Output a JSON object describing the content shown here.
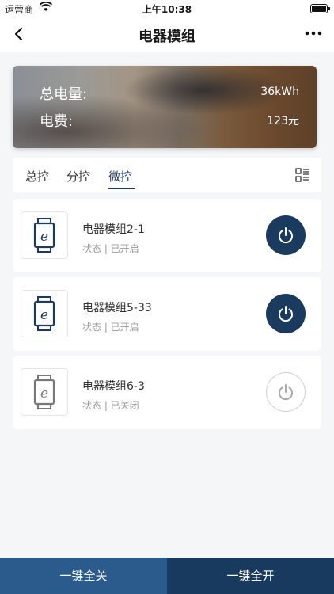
{
  "status_bar": {
    "carrier": "运营商",
    "time": "上午10:38"
  },
  "nav": {
    "title": "电器模组"
  },
  "summary": {
    "total_label": "总电量:",
    "total_value": "36kWh",
    "fee_label": "电费:",
    "fee_value": "123元"
  },
  "tabs": [
    {
      "label": "总控",
      "active": false
    },
    {
      "label": "分控",
      "active": false
    },
    {
      "label": "微控",
      "active": true
    }
  ],
  "devices": [
    {
      "name": "电器模组2-1",
      "status": "状态 | 已开启",
      "on": true
    },
    {
      "name": "电器模组5-33",
      "status": "状态 | 已开启",
      "on": true
    },
    {
      "name": "电器模组6-3",
      "status": "状态 | 已关闭",
      "on": false
    }
  ],
  "actions": {
    "all_off": "一键全关",
    "all_on": "一键全开"
  },
  "colors": {
    "accent": "#1a3a5e",
    "button_off_bg": "#2b5b8d",
    "button_on_bg": "#173a5e"
  },
  "icons": {
    "back": "chevron-left-icon",
    "more": "more-dots-icon",
    "view": "list-view-icon",
    "device": "plug-module-icon",
    "power": "power-icon"
  }
}
